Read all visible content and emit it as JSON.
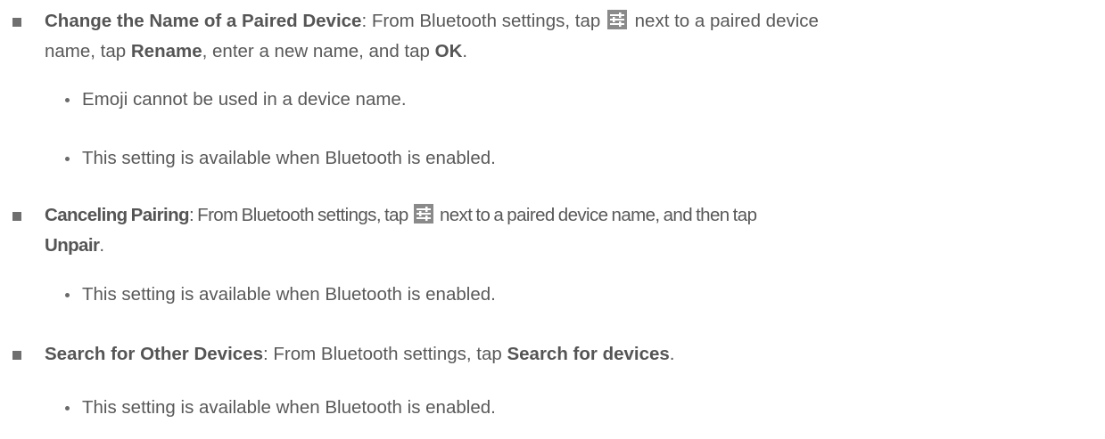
{
  "items": [
    {
      "title": "Change the Name of a Paired Device",
      "text_a": ": From Bluetooth settings, tap",
      "text_b": "next to a paired device",
      "text_c": "name, tap",
      "rename": "Rename",
      "text_d": ", enter a new name, and tap",
      "ok": "OK",
      "text_e": ".",
      "icon": "settings-sliders-icon",
      "notes": [
        "Emoji cannot be used in a device name.",
        "This setting is available when Bluetooth is enabled."
      ]
    },
    {
      "title": "Canceling Pairing",
      "text_a": ": From Bluetooth settings, tap",
      "text_b": "next to a paired device name, and then tap",
      "unpair": "Unpair",
      "text_c": ".",
      "icon": "settings-sliders-icon",
      "notes": [
        "This setting is available when Bluetooth is enabled."
      ]
    },
    {
      "title": "Search for Other Devices",
      "text_a": ": From Bluetooth settings, tap",
      "search": "Search for devices",
      "text_b": ".",
      "notes": [
        "This setting is available when Bluetooth is enabled."
      ]
    }
  ],
  "colors": {
    "text": "#595959",
    "icon_bg": "#8a8a8a"
  }
}
